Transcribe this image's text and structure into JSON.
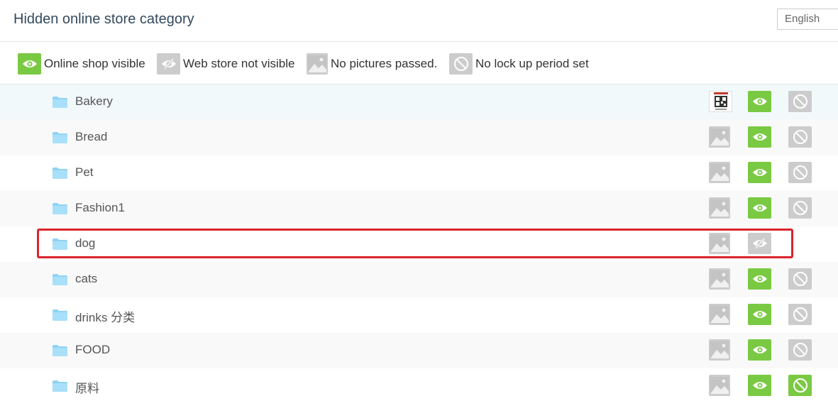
{
  "header": {
    "title": "Hidden online store category",
    "language": "English"
  },
  "legend": [
    {
      "icon": "eye-icon",
      "label": "Online shop visible"
    },
    {
      "icon": "eye-slash-icon",
      "label": "Web store not visible"
    },
    {
      "icon": "image-icon",
      "label": "No pictures passed."
    },
    {
      "icon": "no-lock-icon",
      "label": "No lock up period set"
    }
  ],
  "colors": {
    "visible_green": "#7ac943",
    "inactive_gray": "#cccccc",
    "highlight_red": "#d9242b",
    "folder_blue": "#8fd3f4"
  },
  "categories": [
    {
      "name": "Bakery",
      "image": "qr-thumbnail",
      "visible": true,
      "lock": "not-set"
    },
    {
      "name": "Bread",
      "image": "none",
      "visible": true,
      "lock": "not-set"
    },
    {
      "name": "Pet",
      "image": "none",
      "visible": true,
      "lock": "not-set"
    },
    {
      "name": "Fashion1",
      "image": "none",
      "visible": true,
      "lock": "not-set"
    },
    {
      "name": "dog",
      "image": "none",
      "visible": false,
      "lock": "hidden",
      "highlighted": true
    },
    {
      "name": "cats",
      "image": "none",
      "visible": true,
      "lock": "not-set"
    },
    {
      "name": "drinks 分类",
      "image": "none",
      "visible": true,
      "lock": "not-set"
    },
    {
      "name": "FOOD",
      "image": "none",
      "visible": true,
      "lock": "not-set"
    },
    {
      "name": "原料",
      "image": "none",
      "visible": true,
      "lock": "set-green"
    }
  ]
}
